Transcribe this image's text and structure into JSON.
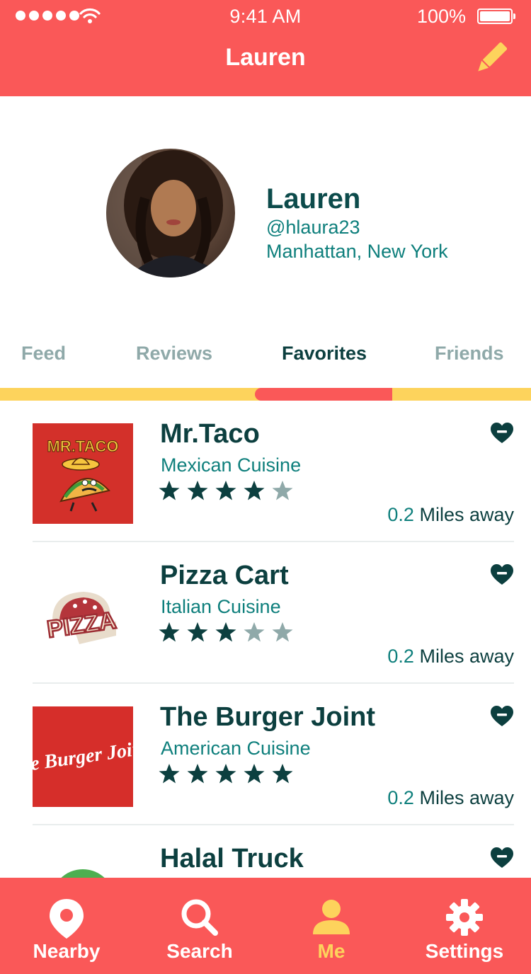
{
  "status_bar": {
    "time": "9:41 AM",
    "battery": "100%"
  },
  "header": {
    "title": "Lauren",
    "edit_icon": "pencil-icon"
  },
  "profile": {
    "name": "Lauren",
    "handle": "@hlaura23",
    "location": "Manhattan, New York"
  },
  "tabs": [
    {
      "label": "Feed",
      "active": false
    },
    {
      "label": "Reviews",
      "active": false
    },
    {
      "label": "Favorites",
      "active": true
    },
    {
      "label": "Friends",
      "active": false
    }
  ],
  "favorites": [
    {
      "name": "Mr.Taco",
      "cuisine": "Mexican Cuisine",
      "rating": 4,
      "distance_value": "0.2",
      "distance_unit": "Miles away",
      "logo_text": "MR.TACO"
    },
    {
      "name": "Pizza Cart",
      "cuisine": "Italian Cuisine",
      "rating": 3,
      "distance_value": "0.2",
      "distance_unit": "Miles away",
      "logo_text": "PIZZA"
    },
    {
      "name": "The Burger Joint",
      "cuisine": "American Cuisine",
      "rating": 5,
      "distance_value": "0.2",
      "distance_unit": "Miles away",
      "logo_text": "the Burger Joint"
    },
    {
      "name": "Halal Truck",
      "cuisine": "",
      "rating": 0,
      "distance_value": "",
      "distance_unit": "",
      "logo_text": ""
    }
  ],
  "bottom_nav": [
    {
      "label": "Nearby",
      "icon": "location-pin-icon",
      "active": false
    },
    {
      "label": "Search",
      "icon": "search-icon",
      "active": false
    },
    {
      "label": "Me",
      "icon": "person-icon",
      "active": true
    },
    {
      "label": "Settings",
      "icon": "gear-icon",
      "active": false
    }
  ],
  "colors": {
    "primary": "#FA5858",
    "accent": "#FDD35C",
    "dark_teal": "#0C3F3F",
    "teal": "#0E7F7C",
    "muted": "#8FA9A9"
  }
}
